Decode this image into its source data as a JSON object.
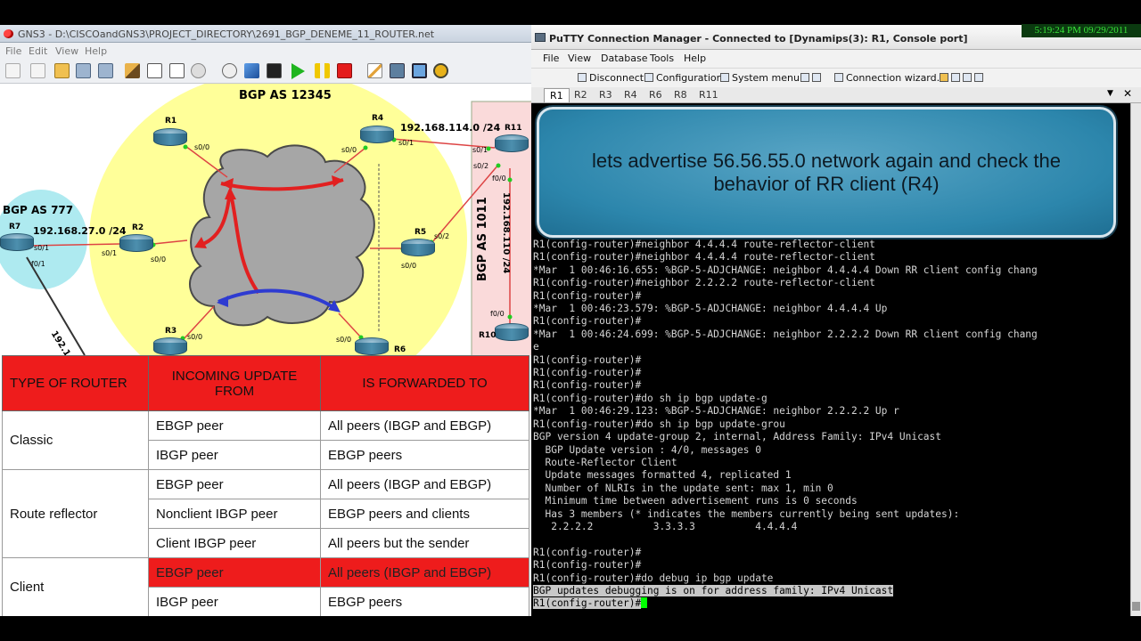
{
  "gns3": {
    "title": "GNS3 - D:\\CISCOandGNS3\\PROJECT_DIRECTORY\\2691_BGP_DENEME_11_ROUTER.net",
    "menu": [
      "File",
      "Edit",
      "View",
      "Help"
    ],
    "topology": {
      "as_main": "BGP AS 12345",
      "as_left": "BGP AS 777",
      "as_right": "BGP AS 1011",
      "net_r4_r11": "192.168.114.0 /24",
      "net_r7_r2": "192.168.27.0 /24",
      "net_r11_r10": "192.168.110 /24",
      "net_r7_partial": "192.16",
      "routers": [
        "R1",
        "R2",
        "R3",
        "R4",
        "R5",
        "R6",
        "R7",
        "R10",
        "R11"
      ],
      "interfaces": {
        "r1_s00": "s0/0",
        "r4_s00": "s0/0",
        "r4_s01": "s0/1",
        "r11_s01": "s0/1",
        "r11_s02": "s0/2",
        "r11_f00": "f0/0",
        "r7_s01": "s0/1",
        "r7_f01": "f0/1",
        "r2_s01": "s0/1",
        "r2_s00": "s0/0",
        "r5_s02": "s0/2",
        "r5_s00": "s0/0",
        "r3_s00": "s0/0",
        "r6_s00": "s0/0",
        "r10_f00": "f0/0"
      }
    }
  },
  "table": {
    "headers": [
      "TYPE OF ROUTER",
      "INCOMING UPDATE FROM",
      "IS FORWARDED TO"
    ],
    "groups": [
      {
        "type": "Classic",
        "rows": [
          [
            "EBGP peer",
            "All peers (IBGP and EBGP)"
          ],
          [
            "IBGP peer",
            "EBGP peers"
          ]
        ]
      },
      {
        "type": "Route reflector",
        "rows": [
          [
            "EBGP peer",
            "All peers (IBGP and EBGP)"
          ],
          [
            "Nonclient IBGP peer",
            "EBGP peers and clients"
          ],
          [
            "Client IBGP peer",
            "All peers but the sender"
          ]
        ]
      },
      {
        "type": "Client",
        "rows": [
          [
            "EBGP peer",
            "All peers (IBGP and EBGP)"
          ],
          [
            "IBGP peer",
            "EBGP peers"
          ]
        ]
      }
    ]
  },
  "putty": {
    "title": "PuTTY Connection Manager - Connected to [Dynamips(3): R1, Console port]",
    "clock": "5:19:24 PM 09/29/2011",
    "menu": [
      "File",
      "View",
      "Database",
      "Tools",
      "Help"
    ],
    "toolbar": [
      "Disconnect",
      "Configuration",
      "System menu",
      "Connection wizard..."
    ],
    "tabs": [
      "R1",
      "R2",
      "R3",
      "R4",
      "R6",
      "R8",
      "R11"
    ],
    "callout": "lets advertise 56.56.55.0 network again and check the behavior of RR client (R4)",
    "terminal_lines": [
      "R1(config-router)#neighbor 4.4.4.4 route-reflector-client",
      "R1(config-router)#neighbor 4.4.4.4 route-reflector-client",
      "*Mar  1 00:46:16.655: %BGP-5-ADJCHANGE: neighbor 4.4.4.4 Down RR client config chang",
      "R1(config-router)#neighbor 2.2.2.2 route-reflector-client",
      "R1(config-router)#",
      "*Mar  1 00:46:23.579: %BGP-5-ADJCHANGE: neighbor 4.4.4.4 Up",
      "R1(config-router)#",
      "*Mar  1 00:46:24.699: %BGP-5-ADJCHANGE: neighbor 2.2.2.2 Down RR client config chang",
      "e",
      "R1(config-router)#",
      "R1(config-router)#",
      "R1(config-router)#",
      "R1(config-router)#do sh ip bgp update-g",
      "*Mar  1 00:46:29.123: %BGP-5-ADJCHANGE: neighbor 2.2.2.2 Up r",
      "R1(config-router)#do sh ip bgp update-grou",
      "BGP version 4 update-group 2, internal, Address Family: IPv4 Unicast",
      "  BGP Update version : 4/0, messages 0",
      "  Route-Reflector Client",
      "  Update messages formatted 4, replicated 1",
      "  Number of NLRIs in the update sent: max 1, min 0",
      "  Minimum time between advertisement runs is 0 seconds",
      "  Has 3 members (* indicates the members currently being sent updates):",
      "   2.2.2.2          3.3.3.3          4.4.4.4",
      "",
      "R1(config-router)#",
      "R1(config-router)#",
      "R1(config-router)#do debug ip bgp update",
      "BGP updates debugging is on for address family: IPv4 Unicast",
      "R1(config-router)#"
    ],
    "colors": {
      "highlight_line_bg": "#c8c8c8",
      "cursor": "#00ff00"
    }
  }
}
